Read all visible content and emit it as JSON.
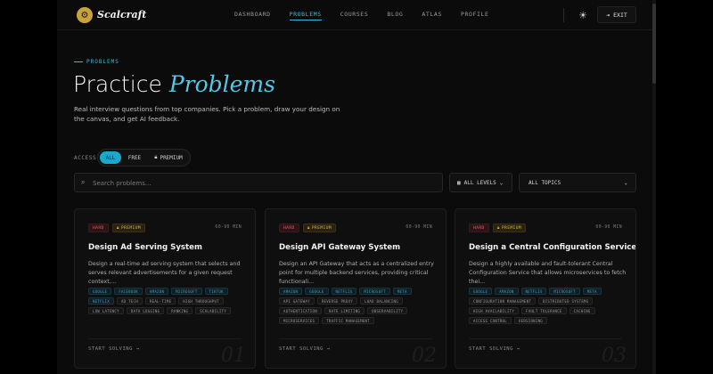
{
  "nav": {
    "brand": "Scalcraft",
    "links": [
      "DASHBOARD",
      "PROBLEMS",
      "COURSES",
      "BLOG",
      "ATLAS",
      "PROFILE"
    ],
    "active": "PROBLEMS",
    "exit_label": "EXIT",
    "accent": "#3fb7d8"
  },
  "hero": {
    "eyebrow": "PROBLEMS",
    "title_plain": "Practice",
    "title_accent": "Problems",
    "subtitle": "Real interview questions from top companies. Pick a problem, draw your design on the canvas, and get AI feedback."
  },
  "filters": {
    "access_label": "ACCESS",
    "access_options": [
      "ALL",
      "FREE",
      "PREMIUM"
    ],
    "access_selected": "ALL",
    "search_placeholder": "Search problems...",
    "levels_label": "ALL LEVELS",
    "topics_label": "ALL TOPICS"
  },
  "cards": [
    {
      "difficulty": "HARD",
      "premium": "PREMIUM",
      "time": "60-90 MIN",
      "title": "Design Ad Serving System",
      "description": "Design a real-time ad serving system that selects and serves relevant advertisements for a given request context,...",
      "companies": [
        "GOOGLE",
        "FACEBOOK",
        "AMAZON",
        "MICROSOFT",
        "TIKTOK",
        "NETFLIX"
      ],
      "topics": [
        "AD TECH",
        "REAL-TIME",
        "HIGH THROUGHPUT",
        "LOW LATENCY",
        "DATA LOGGING",
        "RANKING",
        "SCALABILITY"
      ],
      "cta": "START SOLVING",
      "number": "01"
    },
    {
      "difficulty": "HARD",
      "premium": "PREMIUM",
      "time": "60-90 MIN",
      "title": "Design API Gateway System",
      "description": "Design an API Gateway that acts as a centralized entry point for multiple backend services, providing critical functionali...",
      "companies": [
        "AMAZON",
        "GOOGLE",
        "NETFLIX",
        "MICROSOFT",
        "META"
      ],
      "topics": [
        "API GATEWAY",
        "REVERSE PROXY",
        "LOAD BALANCING",
        "AUTHENTICATION",
        "RATE LIMITING",
        "OBSERVABILITY",
        "MICROSERVICES",
        "TRAFFIC MANAGEMENT"
      ],
      "cta": "START SOLVING",
      "number": "02"
    },
    {
      "difficulty": "HARD",
      "premium": "PREMIUM",
      "time": "60-90 MIN",
      "title": "Design a Central Configuration Service",
      "description": "Design a highly available and fault-tolerant Central Configuration Service that allows microservices to fetch thei...",
      "companies": [
        "GOOGLE",
        "AMAZON",
        "NETFLIX",
        "MICROSOFT",
        "META"
      ],
      "topics": [
        "CONFIGURATION MANAGEMENT",
        "DISTRIBUTED SYSTEMS",
        "HIGH AVAILABILITY",
        "FAULT TOLERANCE",
        "CACHING",
        "ACCESS CONTROL",
        "VERSIONING"
      ],
      "cta": "START SOLVING",
      "number": "03"
    }
  ]
}
